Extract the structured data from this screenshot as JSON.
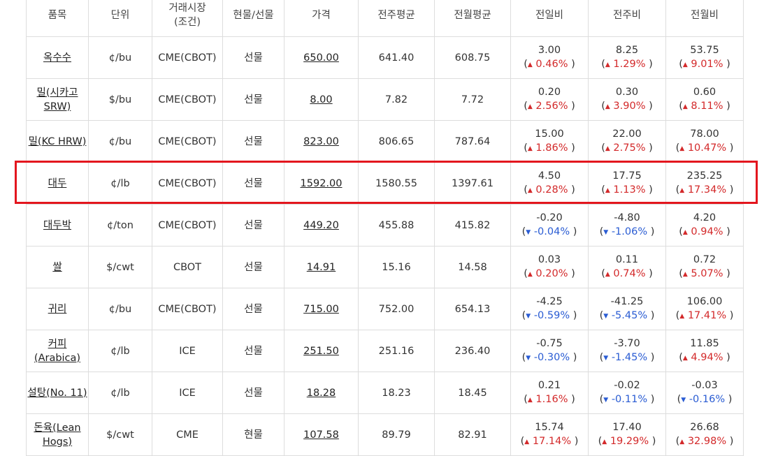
{
  "headers": [
    "품목",
    "단위",
    "거래시장\n(조건)",
    "현물/선물",
    "가격",
    "전주평균",
    "전월평균",
    "전일비",
    "전주비",
    "전월비"
  ],
  "colors": {
    "up": "#d3292a",
    "down": "#2a5cd3",
    "highlight": "#e3161e"
  },
  "highlighted_row": "대두",
  "rows": [
    {
      "item": "옥수수",
      "unit": "¢/bu",
      "market": "CME(CBOT)",
      "type": "선물",
      "price": "650.00",
      "week_avg": "641.40",
      "month_avg": "608.75",
      "day": {
        "value": "3.00",
        "dir": "up",
        "pct": "0.46%"
      },
      "week": {
        "value": "8.25",
        "dir": "up",
        "pct": "1.29%"
      },
      "month": {
        "value": "53.75",
        "dir": "up",
        "pct": "9.01%"
      }
    },
    {
      "item": "밀(시카고 SRW)",
      "unit": "$/bu",
      "market": "CME(CBOT)",
      "type": "선물",
      "price": "8.00",
      "week_avg": "7.82",
      "month_avg": "7.72",
      "day": {
        "value": "0.20",
        "dir": "up",
        "pct": "2.56%"
      },
      "week": {
        "value": "0.30",
        "dir": "up",
        "pct": "3.90%"
      },
      "month": {
        "value": "0.60",
        "dir": "up",
        "pct": "8.11%"
      }
    },
    {
      "item": "밀(KC HRW)",
      "unit": "¢/bu",
      "market": "CME(CBOT)",
      "type": "선물",
      "price": "823.00",
      "week_avg": "806.65",
      "month_avg": "787.64",
      "day": {
        "value": "15.00",
        "dir": "up",
        "pct": "1.86%"
      },
      "week": {
        "value": "22.00",
        "dir": "up",
        "pct": "2.75%"
      },
      "month": {
        "value": "78.00",
        "dir": "up",
        "pct": "10.47%"
      }
    },
    {
      "item": "대두",
      "unit": "¢/lb",
      "market": "CME(CBOT)",
      "type": "선물",
      "price": "1592.00",
      "week_avg": "1580.55",
      "month_avg": "1397.61",
      "day": {
        "value": "4.50",
        "dir": "up",
        "pct": "0.28%"
      },
      "week": {
        "value": "17.75",
        "dir": "up",
        "pct": "1.13%"
      },
      "month": {
        "value": "235.25",
        "dir": "up",
        "pct": "17.34%"
      }
    },
    {
      "item": "대두박",
      "unit": "¢/ton",
      "market": "CME(CBOT)",
      "type": "선물",
      "price": "449.20",
      "week_avg": "455.88",
      "month_avg": "415.82",
      "day": {
        "value": "-0.20",
        "dir": "down",
        "pct": "-0.04%"
      },
      "week": {
        "value": "-4.80",
        "dir": "down",
        "pct": "-1.06%"
      },
      "month": {
        "value": "4.20",
        "dir": "up",
        "pct": "0.94%"
      }
    },
    {
      "item": "쌀",
      "unit": "$/cwt",
      "market": "CBOT",
      "type": "선물",
      "price": "14.91",
      "week_avg": "15.16",
      "month_avg": "14.58",
      "day": {
        "value": "0.03",
        "dir": "up",
        "pct": "0.20%"
      },
      "week": {
        "value": "0.11",
        "dir": "up",
        "pct": "0.74%"
      },
      "month": {
        "value": "0.72",
        "dir": "up",
        "pct": "5.07%"
      }
    },
    {
      "item": "귀리",
      "unit": "¢/bu",
      "market": "CME(CBOT)",
      "type": "선물",
      "price": "715.00",
      "week_avg": "752.00",
      "month_avg": "654.13",
      "day": {
        "value": "-4.25",
        "dir": "down",
        "pct": "-0.59%"
      },
      "week": {
        "value": "-41.25",
        "dir": "down",
        "pct": "-5.45%"
      },
      "month": {
        "value": "106.00",
        "dir": "up",
        "pct": "17.41%"
      }
    },
    {
      "item": "커피 (Arabica)",
      "unit": "¢/lb",
      "market": "ICE",
      "type": "선물",
      "price": "251.50",
      "week_avg": "251.16",
      "month_avg": "236.40",
      "day": {
        "value": "-0.75",
        "dir": "down",
        "pct": "-0.30%"
      },
      "week": {
        "value": "-3.70",
        "dir": "down",
        "pct": "-1.45%"
      },
      "month": {
        "value": "11.85",
        "dir": "up",
        "pct": "4.94%"
      }
    },
    {
      "item": "설탕(No. 11)",
      "unit": "¢/lb",
      "market": "ICE",
      "type": "선물",
      "price": "18.28",
      "week_avg": "18.23",
      "month_avg": "18.45",
      "day": {
        "value": "0.21",
        "dir": "up",
        "pct": "1.16%"
      },
      "week": {
        "value": "-0.02",
        "dir": "down",
        "pct": "-0.11%"
      },
      "month": {
        "value": "-0.03",
        "dir": "down",
        "pct": "-0.16%"
      }
    },
    {
      "item": "돈육(Lean Hogs)",
      "unit": "$/cwt",
      "market": "CME",
      "type": "현물",
      "price": "107.58",
      "week_avg": "89.79",
      "month_avg": "82.91",
      "day": {
        "value": "15.74",
        "dir": "up",
        "pct": "17.14%"
      },
      "week": {
        "value": "17.40",
        "dir": "up",
        "pct": "19.29%"
      },
      "month": {
        "value": "26.68",
        "dir": "up",
        "pct": "32.98%"
      }
    }
  ]
}
